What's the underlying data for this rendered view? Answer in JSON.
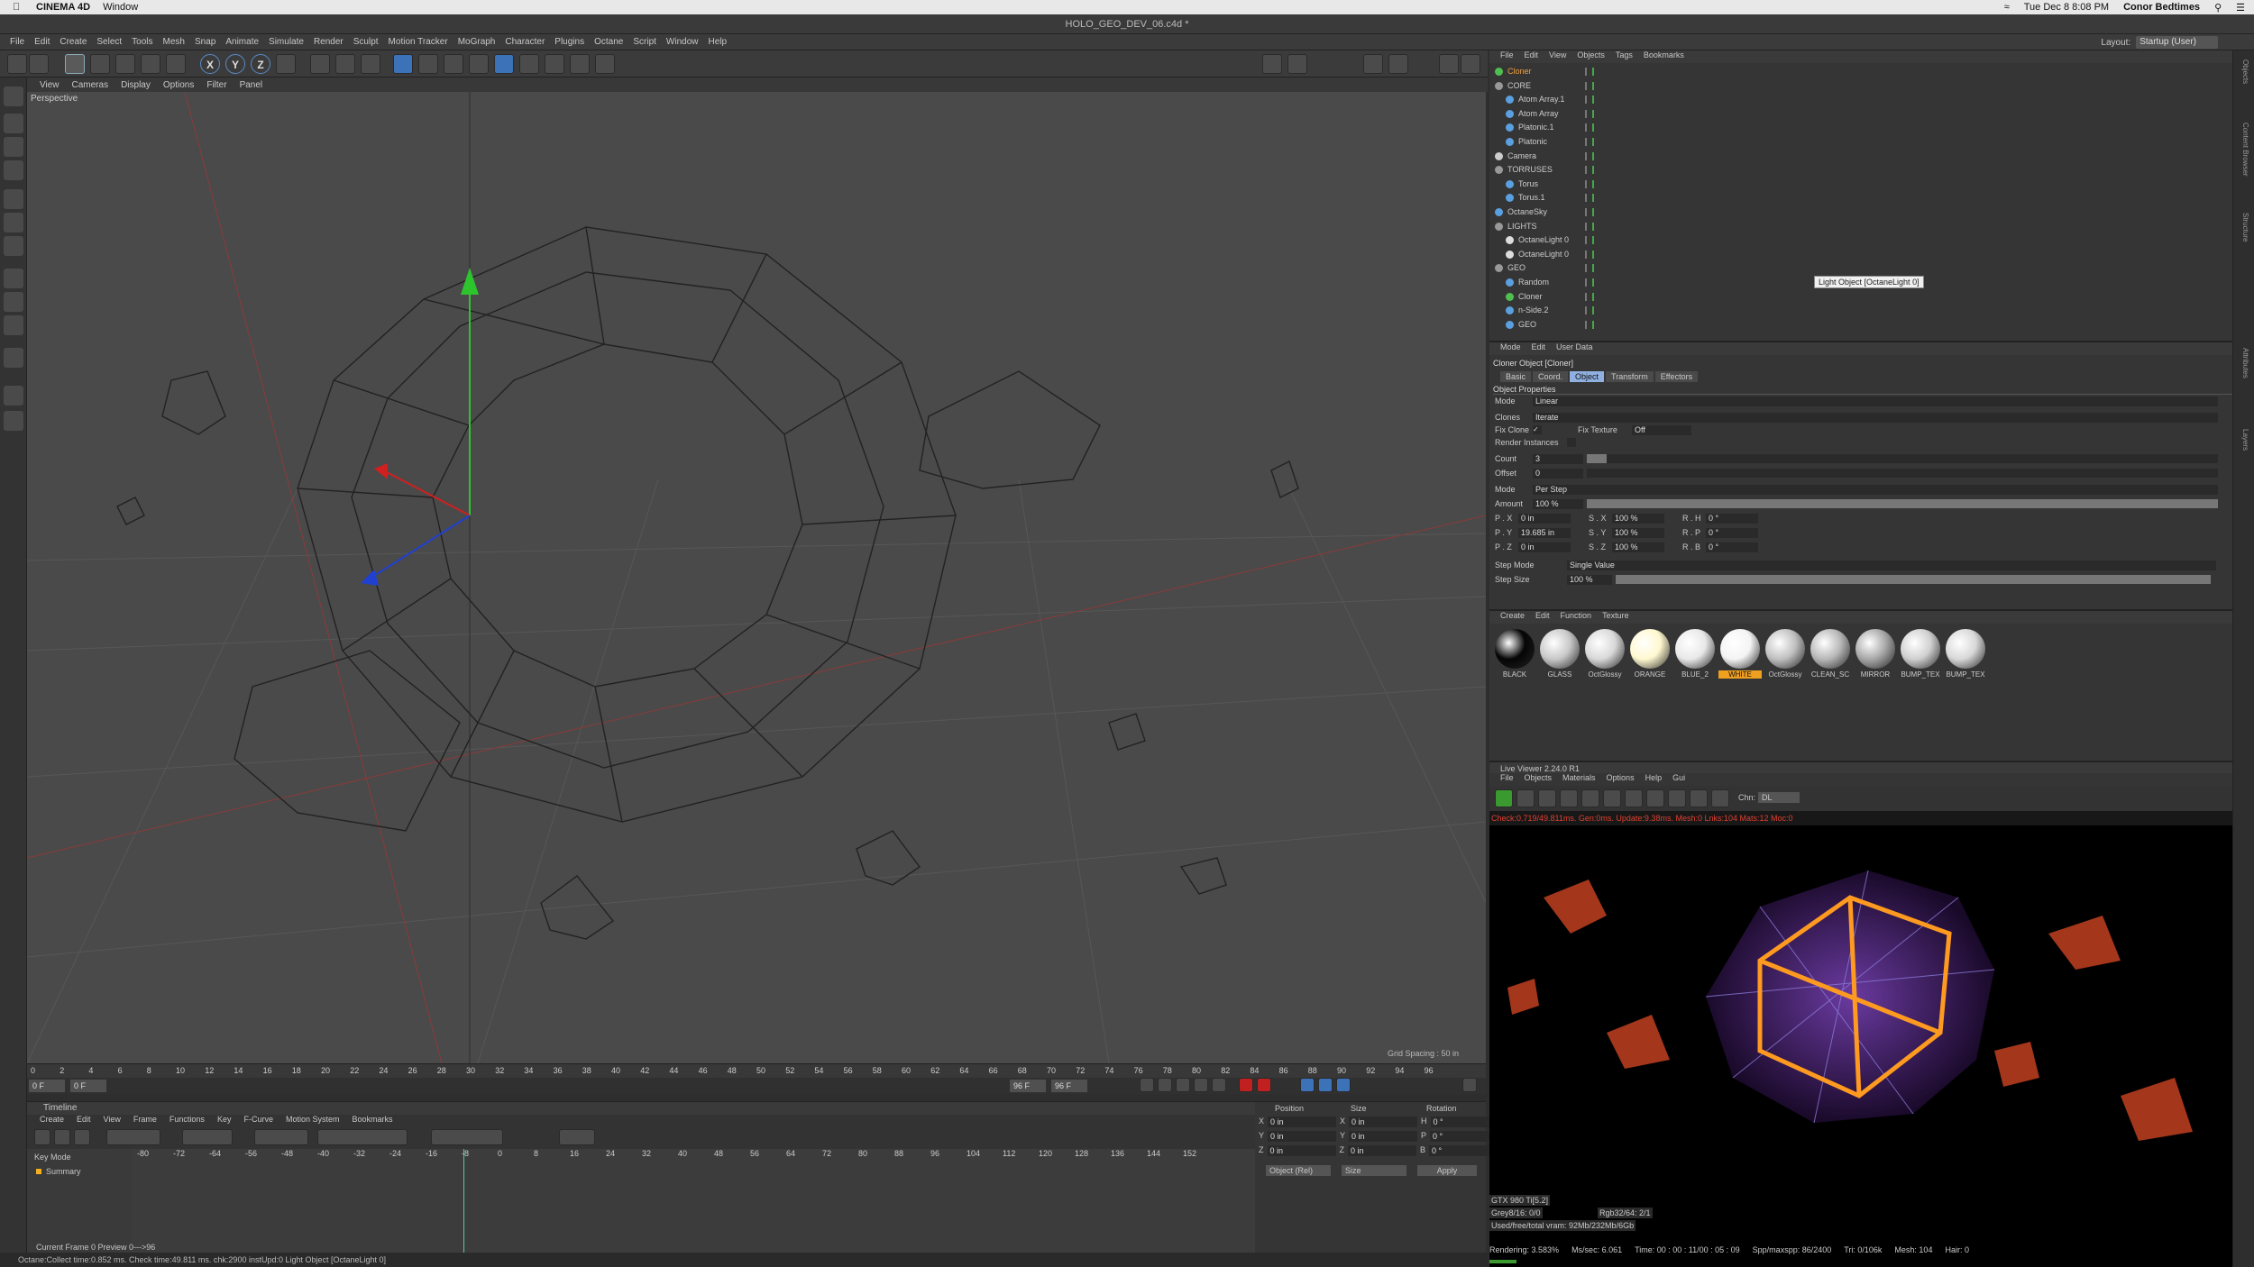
{
  "mac_menubar": {
    "app": "CINEMA 4D",
    "menus": [
      "Window"
    ],
    "clock": "Tue Dec 8  8:08 PM",
    "user": "Conor Bedtimes"
  },
  "window_title": "HOLO_GEO_DEV_06.c4d *",
  "main_menu": [
    "File",
    "Edit",
    "Create",
    "Select",
    "Tools",
    "Mesh",
    "Snap",
    "Animate",
    "Simulate",
    "Render",
    "Sculpt",
    "Motion Tracker",
    "MoGraph",
    "Character",
    "Plugins",
    "Octane",
    "Script",
    "Window",
    "Help"
  ],
  "layout": {
    "label": "Layout:",
    "value": "Startup (User)"
  },
  "toolbar": {
    "axis_x": "X",
    "axis_y": "Y",
    "axis_z": "Z"
  },
  "viewport": {
    "menu": [
      "View",
      "Cameras",
      "Display",
      "Options",
      "Filter",
      "Panel"
    ],
    "label": "Perspective",
    "grid_spacing": "Grid Spacing : 50 in"
  },
  "ruler": {
    "ticks": [
      "0",
      "2",
      "4",
      "6",
      "8",
      "10",
      "12",
      "14",
      "16",
      "18",
      "20",
      "22",
      "24",
      "26",
      "28",
      "30",
      "32",
      "34",
      "36",
      "38",
      "40",
      "42",
      "44",
      "46",
      "48",
      "50",
      "52",
      "54",
      "56",
      "58",
      "60",
      "62",
      "64",
      "66",
      "68",
      "70",
      "72",
      "74",
      "76",
      "78",
      "80",
      "82",
      "84",
      "86",
      "88",
      "90",
      "92",
      "94",
      "96"
    ],
    "end_field": "0 F"
  },
  "scrub": {
    "start": "0 F",
    "start2": "0 F",
    "end": "96 F",
    "end2": "96 F"
  },
  "timeline": {
    "title": "Timeline",
    "menu": [
      "Create",
      "Edit",
      "View",
      "Frame",
      "Functions",
      "Key",
      "F-Curve",
      "Motion System",
      "Bookmarks"
    ],
    "key_mode": "Key Mode",
    "summary": "Summary",
    "ticks": [
      "-80",
      "-72",
      "-64",
      "-56",
      "-48",
      "-40",
      "-32",
      "-24",
      "-16",
      "-8",
      "0",
      "8",
      "16",
      "24",
      "32",
      "40",
      "48",
      "56",
      "64",
      "72",
      "80",
      "88",
      "96",
      "104",
      "112",
      "120",
      "128",
      "136",
      "144",
      "152"
    ],
    "current_frame": "Current Frame  0   Preview  0--->96"
  },
  "coords": {
    "headers": [
      "Position",
      "Size",
      "Rotation"
    ],
    "rows": [
      {
        "p_label": "X",
        "p": "0 in",
        "s_label": "X",
        "s": "0 in",
        "r_label": "H",
        "r": "0 °"
      },
      {
        "p_label": "Y",
        "p": "0 in",
        "s_label": "Y",
        "s": "0 in",
        "r_label": "P",
        "r": "0 °"
      },
      {
        "p_label": "Z",
        "p": "0 in",
        "s_label": "Z",
        "s": "0 in",
        "r_label": "B",
        "r": "0 °"
      }
    ],
    "mode": "Object (Rel)",
    "size_mode": "Size",
    "apply": "Apply"
  },
  "status": "Octane:Collect time:0.852 ms.  Check time:49.811 ms.  chk:2900  instUpd:0     Light Object [OctaneLight 0]",
  "object_manager": {
    "menu": [
      "File",
      "Edit",
      "View",
      "Objects",
      "Tags",
      "Bookmarks"
    ],
    "items": [
      {
        "name": "Cloner",
        "indent": 0,
        "color": "#4fc04f",
        "selected": true
      },
      {
        "name": "CORE",
        "indent": 0,
        "color": "#999999",
        "selected": false
      },
      {
        "name": "Atom Array.1",
        "indent": 1,
        "color": "#5aa0e0",
        "selected": false
      },
      {
        "name": "Atom Array",
        "indent": 1,
        "color": "#5aa0e0",
        "selected": false
      },
      {
        "name": "Platonic.1",
        "indent": 1,
        "color": "#5aa0e0",
        "selected": false
      },
      {
        "name": "Platonic",
        "indent": 1,
        "color": "#5aa0e0",
        "selected": false
      },
      {
        "name": "Camera",
        "indent": 0,
        "color": "#cccccc",
        "selected": false
      },
      {
        "name": "TORRUSES",
        "indent": 0,
        "color": "#999999",
        "selected": false
      },
      {
        "name": "Torus",
        "indent": 1,
        "color": "#5aa0e0",
        "selected": false
      },
      {
        "name": "Torus.1",
        "indent": 1,
        "color": "#5aa0e0",
        "selected": false
      },
      {
        "name": "OctaneSky",
        "indent": 0,
        "color": "#5aa0e0",
        "selected": false
      },
      {
        "name": "LIGHTS",
        "indent": 0,
        "color": "#999999",
        "selected": false
      },
      {
        "name": "OctaneLight 0",
        "indent": 1,
        "color": "#dddddd",
        "selected": false
      },
      {
        "name": "OctaneLight 0",
        "indent": 1,
        "color": "#dddddd",
        "selected": false
      },
      {
        "name": "GEO",
        "indent": 0,
        "color": "#999999",
        "selected": false
      },
      {
        "name": "Random",
        "indent": 1,
        "color": "#5aa0e0",
        "selected": false
      },
      {
        "name": "Cloner",
        "indent": 1,
        "color": "#4fc04f",
        "selected": false
      },
      {
        "name": "n-Side.2",
        "indent": 1,
        "color": "#5aa0e0",
        "selected": false
      },
      {
        "name": "GEO",
        "indent": 1,
        "color": "#5aa0e0",
        "selected": false
      }
    ],
    "tooltip": "Light Object [OctaneLight 0]"
  },
  "attributes": {
    "menu": [
      "Mode",
      "Edit",
      "User Data"
    ],
    "title": "Cloner Object [Cloner]",
    "tabs": [
      "Basic",
      "Coord.",
      "Object",
      "Transform",
      "Effectors"
    ],
    "active_tab": "Object",
    "section": "Object Properties",
    "mode_label": "Mode",
    "mode_value": "Linear",
    "clones_label": "Clones",
    "clones_value": "Iterate",
    "fix_clone": "Fix Clone",
    "fix_texture": "Fix Texture",
    "fix_texture_value": "Off",
    "render_instances": "Render Instances",
    "count_label": "Count",
    "count_value": "3",
    "offset_label": "Offset",
    "offset_value": "0",
    "mode2_label": "Mode",
    "mode2_value": "Per Step",
    "amount_label": "Amount",
    "amount_value": "100 %",
    "px": "0 in",
    "py": "19.685 in",
    "pz": "0 in",
    "sx": "100 %",
    "sy": "100 %",
    "sz": "100 %",
    "rh": "0 °",
    "rp": "0 °",
    "rb": "0 °",
    "step_mode_label": "Step Mode",
    "step_mode_value": "Single Value",
    "step_size_label": "Step Size",
    "step_size_value": "100 %"
  },
  "materials": {
    "menu": [
      "Create",
      "Edit",
      "Function",
      "Texture"
    ],
    "items": [
      {
        "name": "BLACK",
        "color": "#050505",
        "selected": false
      },
      {
        "name": "GLASS",
        "color": "#c8c8c8",
        "selected": false
      },
      {
        "name": "OctGlossy",
        "color": "#d8d8d8",
        "selected": false
      },
      {
        "name": "ORANGE",
        "color": "#fff8d0",
        "selected": false
      },
      {
        "name": "BLUE_2",
        "color": "#e8e8e8",
        "selected": false
      },
      {
        "name": "WHITE",
        "color": "#f4f4f4",
        "selected": true
      },
      {
        "name": "OctGlossy",
        "color": "#c0c0c0",
        "selected": false
      },
      {
        "name": "CLEAN_SC",
        "color": "#b8b8b8",
        "selected": false
      },
      {
        "name": "MIRROR",
        "color": "#a8a8a8",
        "selected": false
      },
      {
        "name": "BUMP_TEX",
        "color": "#d0d0d0",
        "selected": false
      },
      {
        "name": "BUMP_TEX",
        "color": "#d8d8d8",
        "selected": false
      }
    ]
  },
  "live_viewer": {
    "title": "Live Viewer 2.24.0 R1",
    "menu": [
      "File",
      "Objects",
      "Materials",
      "Options",
      "Help",
      "Gui"
    ],
    "chn_label": "Chn:",
    "chn_value": "DL",
    "status": "Check:0.719/49.811ms. Gen:0ms. Update:9.38ms. Mesh:0 Lnks:104 Mats:12 Moc:0",
    "gpu": "GTX 980 Ti[5.2]",
    "grey": "Grey8/16: 0/0",
    "rgb": "Rgb32/64: 2/1",
    "vram": "Used/free/total vram: 92Mb/232Mb/6Gb",
    "rendering": "Rendering: 3.583%",
    "mssec": "Ms/sec: 6.061",
    "time": "Time: 00 : 00 : 11/00 : 05 : 09",
    "spp": "Spp/maxspp: 86/2400",
    "tri": "Tri: 0/106k",
    "mesh": "Mesh: 104",
    "hair": "Hair: 0"
  },
  "right_tabs": [
    "Objects",
    "Content Browser",
    "Structure",
    "Attributes",
    "Layers"
  ]
}
